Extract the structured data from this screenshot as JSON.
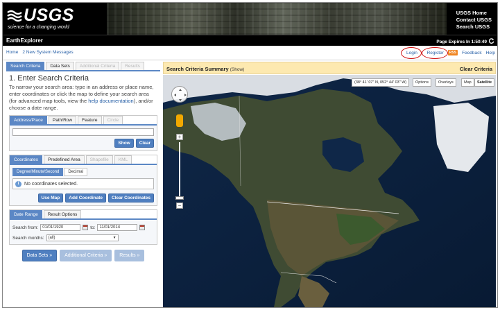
{
  "header": {
    "logo_text": "USGS",
    "tagline": "science for a changing world",
    "links": [
      "USGS Home",
      "Contact USGS",
      "Search USGS"
    ]
  },
  "titlebar": {
    "app_title": "EarthExplorer",
    "expires_label": "Page Expires In 1:50:49",
    "refresh_icon": "refresh-icon"
  },
  "nav": {
    "home": "Home",
    "messages": "2 New System Messages",
    "login": "Login",
    "register": "Register",
    "rss": "RSS",
    "feedback": "Feedback",
    "help": "Help"
  },
  "left": {
    "tabs": [
      "Search Criteria",
      "Data Sets",
      "Additional Criteria",
      "Results"
    ],
    "step_title": "1. Enter Search Criteria",
    "intro_part1": "To narrow your search area: type in an address or place name, enter coordinates or click the map to define your search area (for advanced map tools, view the ",
    "intro_link": "help documentation",
    "intro_part2": "), and/or choose a date range.",
    "address_tabs": [
      "Address/Place",
      "Path/Row",
      "Feature",
      "Circle"
    ],
    "address_value": "",
    "show_btn": "Show",
    "clear_btn": "Clear",
    "coord_tabs": [
      "Coordinates",
      "Predefined Area",
      "Shapefile",
      "KML"
    ],
    "coord_format_tabs": [
      "Degree/Minute/Second",
      "Decimal"
    ],
    "no_coords": "No coordinates selected.",
    "use_map_btn": "Use Map",
    "add_coord_btn": "Add Coordinate",
    "clear_coords_btn": "Clear Coordinates",
    "date_tabs": [
      "Date Range",
      "Result Options"
    ],
    "search_from_label": "Search from:",
    "date_from": "01/01/1920",
    "to_label": "to:",
    "date_to": "11/01/2014",
    "search_months_label": "Search months:",
    "months_value": "(all)",
    "bottom_buttons": [
      "Data Sets »",
      "Additional Criteria »",
      "Results »"
    ]
  },
  "map": {
    "summary_title": "Search Criteria Summary",
    "summary_show": "(Show)",
    "clear_criteria": "Clear Criteria",
    "coord_readout": "(38° 41' 07\" N, 052° 44' 03\" W)",
    "options_btn": "Options",
    "overlays_btn": "Overlays",
    "map_btn": "Map",
    "satellite_btn": "Satellite",
    "zoom_plus": "+",
    "zoom_minus": "−"
  },
  "colors": {
    "accent": "#5b87c5",
    "button": "#4f7fc0",
    "link": "#2a62a8",
    "summary_bg": "#fde9b0",
    "circle_annotation": "#d01010"
  }
}
